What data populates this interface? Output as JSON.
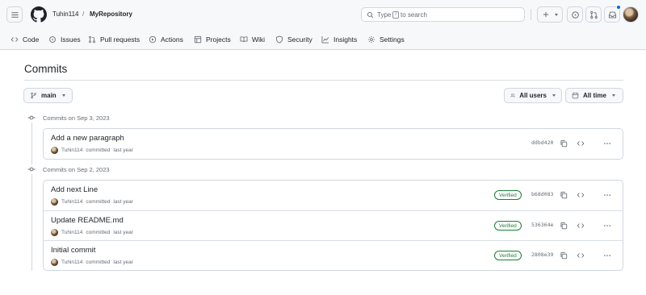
{
  "header": {
    "owner": "Tuhin114",
    "separator": "/",
    "repo": "MyRepository",
    "search_prefix": "Type",
    "search_key": "/",
    "search_suffix": "to search",
    "accent": "#0969da"
  },
  "nav": [
    {
      "label": "Code",
      "icon": "code-icon"
    },
    {
      "label": "Issues",
      "icon": "issue-icon"
    },
    {
      "label": "Pull requests",
      "icon": "pull-request-icon"
    },
    {
      "label": "Actions",
      "icon": "play-icon"
    },
    {
      "label": "Projects",
      "icon": "table-icon"
    },
    {
      "label": "Wiki",
      "icon": "book-icon"
    },
    {
      "label": "Security",
      "icon": "shield-icon"
    },
    {
      "label": "Insights",
      "icon": "graph-icon"
    },
    {
      "label": "Settings",
      "icon": "gear-icon"
    }
  ],
  "page": {
    "title": "Commits",
    "branch": "main",
    "users_filter": "All users",
    "time_filter": "All time"
  },
  "groups": [
    {
      "heading": "Commits on Sep 3, 2023",
      "commits": [
        {
          "message": "Add a new paragraph",
          "author": "Tuhin114",
          "action": "committed",
          "when": "last year",
          "verified": "",
          "sha": "ddbd420"
        }
      ]
    },
    {
      "heading": "Commits on Sep 2, 2023",
      "commits": [
        {
          "message": "Add next Line",
          "author": "Tuhin114",
          "action": "committed",
          "when": "last year",
          "verified": "Verified",
          "sha": "b68d083"
        },
        {
          "message": "Update README.md",
          "author": "Tuhin114",
          "action": "committed",
          "when": "last year",
          "verified": "Verified",
          "sha": "536364e"
        },
        {
          "message": "Initial commit",
          "author": "Tuhin114",
          "action": "committed",
          "when": "last year",
          "verified": "Verified",
          "sha": "2808e39"
        }
      ]
    }
  ]
}
